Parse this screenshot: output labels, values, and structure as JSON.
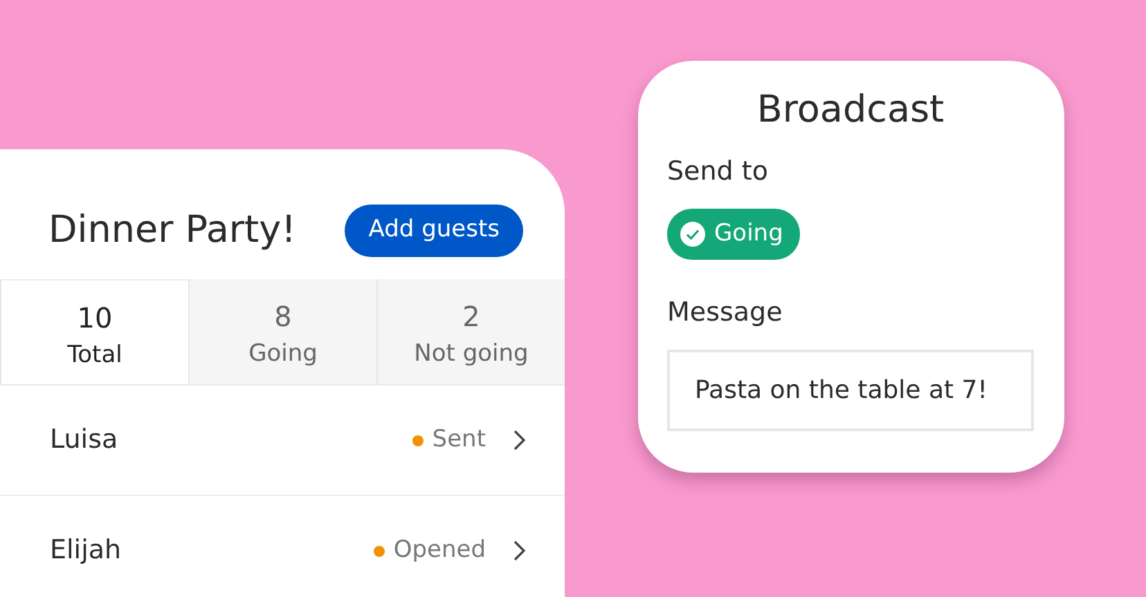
{
  "event": {
    "title": "Dinner Party!",
    "add_button": "Add guests",
    "stats": [
      {
        "value": "10",
        "label": "Total",
        "selected": true
      },
      {
        "value": "8",
        "label": "Going",
        "selected": false
      },
      {
        "value": "2",
        "label": "Not going",
        "selected": false
      }
    ],
    "guests": [
      {
        "name": "Luisa",
        "status": "Sent",
        "color": "#f39200"
      },
      {
        "name": "Elijah",
        "status": "Opened",
        "color": "#f39200"
      }
    ]
  },
  "broadcast": {
    "title": "Broadcast",
    "send_to_label": "Send to",
    "chip": {
      "label": "Going",
      "selected": true
    },
    "message_label": "Message",
    "message": "Pasta on the table at 7!"
  }
}
